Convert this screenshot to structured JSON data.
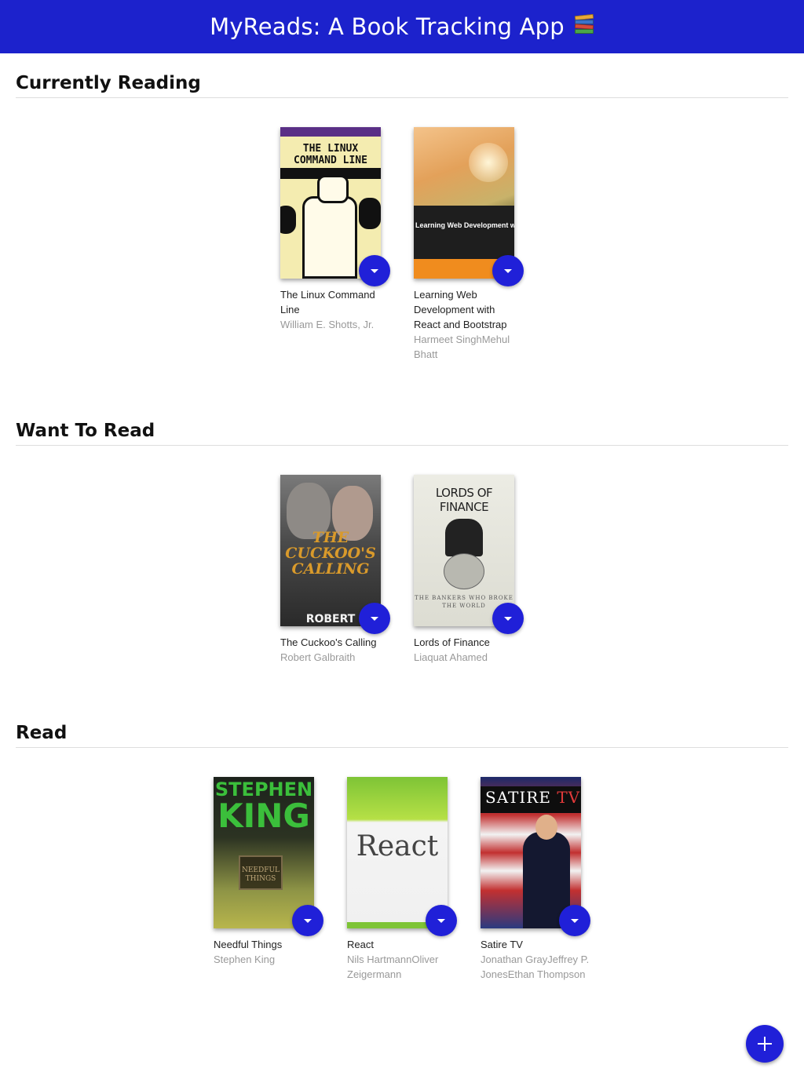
{
  "header": {
    "title": "MyReads: A Book Tracking App",
    "emoji_icon": "books-icon"
  },
  "colors": {
    "primary": "#1c22cc",
    "button": "#2020d8"
  },
  "shelves": [
    {
      "title": "Currently Reading",
      "books": [
        {
          "title": "The Linux Command Line",
          "authors": "William E. Shotts, Jr.",
          "cover_text": "THE LINUX COMMAND LINE"
        },
        {
          "title": "Learning Web Development with React and Bootstrap",
          "authors": "Harmeet SinghMehul Bhatt",
          "cover_text": "Learning Web Development with React and Bootstrap"
        }
      ]
    },
    {
      "title": "Want To Read",
      "books": [
        {
          "title": "The Cuckoo's Calling",
          "authors": "Robert Galbraith",
          "cover_text": "THE CUCKOO'S CALLING",
          "cover_author": "ROBERT GALBRAITH"
        },
        {
          "title": "Lords of Finance",
          "authors": "Liaquat Ahamed",
          "cover_text": "LORDS OF FINANCE",
          "cover_sub": "THE BANKERS WHO BROKE THE WORLD"
        }
      ]
    },
    {
      "title": "Read",
      "books": [
        {
          "title": "Needful Things",
          "authors": "Stephen King",
          "cover_text_1": "STEPHEN",
          "cover_text_2": "KING",
          "cover_sign": "NEEDFUL THINGS"
        },
        {
          "title": "React",
          "authors": "Nils HartmannOliver Zeigermann",
          "cover_text": "React"
        },
        {
          "title": "Satire TV",
          "authors": "Jonathan GrayJeffrey P. JonesEthan Thompson",
          "cover_text": "SATIRE",
          "cover_text_2": "TV"
        }
      ]
    }
  ],
  "actions": {
    "shelf_changer_icon": "caret-down-icon",
    "add_book_icon": "plus-icon"
  }
}
